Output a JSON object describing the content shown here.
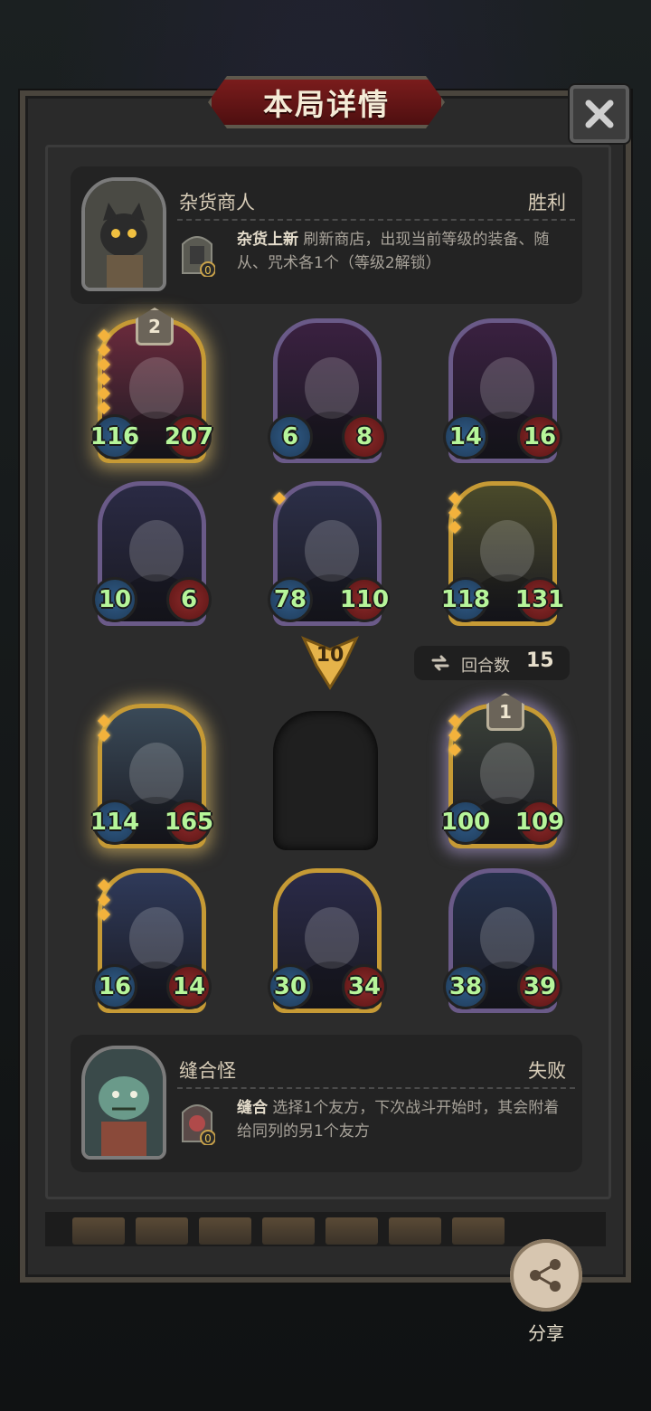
{
  "header": {
    "title": "本局详情"
  },
  "top_player": {
    "name": "杂货商人",
    "result": "胜利",
    "skill_cost": "0",
    "skill_name": "杂货上新",
    "skill_text": "刷新商店，出现当前等级的装备、随从、咒术各1个（等级2解锁）"
  },
  "bottom_player": {
    "name": "缝合怪",
    "result": "失败",
    "skill_cost": "0",
    "skill_name": "缝合",
    "skill_text": "选择1个友方，下次战斗开始时，其会附着给同列的另1个友方"
  },
  "top_board": [
    {
      "atk": "116",
      "hp": "207",
      "level": "2",
      "pips": 6,
      "art": "armored-warrior",
      "frame": "#c69a35",
      "bg": "#6a2a3c",
      "glow": true
    },
    {
      "atk": "6",
      "hp": "8",
      "art": "clown",
      "frame": "#6a5a88",
      "bg": "#3a2040"
    },
    {
      "atk": "14",
      "hp": "16",
      "art": "clown",
      "frame": "#6a5a88",
      "bg": "#3a2040"
    },
    {
      "atk": "10",
      "hp": "6",
      "art": "hooded-reaper",
      "frame": "#6a5a88",
      "bg": "#2a2a44"
    },
    {
      "atk": "78",
      "hp": "110",
      "pips": 1,
      "art": "dark-sorceress",
      "frame": "#6a5a88",
      "bg": "#2c2f48"
    },
    {
      "atk": "118",
      "hp": "131",
      "pips": 3,
      "art": "grinning-devil",
      "frame": "#c69a35",
      "bg": "#4a4a2a"
    }
  ],
  "level_marker": "10",
  "turn": {
    "label": "回合数",
    "value": "15"
  },
  "bottom_board": [
    {
      "atk": "114",
      "hp": "165",
      "pips": 2,
      "art": "spiky-hair-boy",
      "frame": "#c69a35",
      "bg": "#3a4a58",
      "glow": true
    },
    null,
    {
      "atk": "100",
      "hp": "109",
      "level": "1",
      "pips": 3,
      "art": "ghost-horse",
      "frame": "#c69a35",
      "bg": "#3a4038",
      "glow_purple": true
    },
    {
      "atk": "16",
      "hp": "14",
      "pips": 3,
      "art": "bearded-king",
      "frame": "#c69a35",
      "bg": "#2f3a5a"
    },
    {
      "atk": "30",
      "hp": "34",
      "art": "blue-haired-mage",
      "frame": "#c69a35",
      "bg": "#2a2a48"
    },
    {
      "atk": "38",
      "hp": "39",
      "art": "spirit-whale",
      "frame": "#6a5a88",
      "bg": "#24304a"
    }
  ],
  "share": {
    "label": "分享"
  },
  "colors": {
    "atk_text": "#b6f59a",
    "gold_frame": "#c69a35",
    "panel": "#2a2a2a"
  }
}
